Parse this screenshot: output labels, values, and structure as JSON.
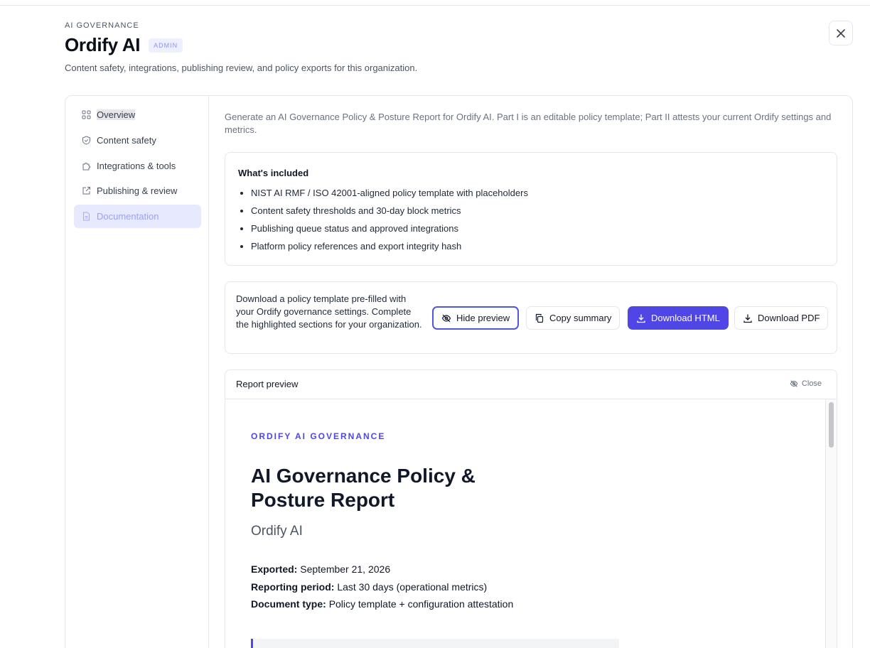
{
  "header": {
    "eyebrow": "AI GOVERNANCE",
    "title": "Ordify AI",
    "badge": "ADMIN",
    "subtitle": "Content safety, integrations, publishing review, and policy exports for this organization."
  },
  "sidebar": {
    "items": [
      {
        "label": "Overview",
        "icon": "grid-icon"
      },
      {
        "label": "Content safety",
        "icon": "shield-icon"
      },
      {
        "label": "Integrations & tools",
        "icon": "puzzle-icon"
      },
      {
        "label": "Publishing & review",
        "icon": "external-link-icon"
      },
      {
        "label": "Documentation",
        "icon": "document-icon",
        "active": true
      }
    ]
  },
  "main": {
    "intro": "Generate an AI Governance Policy & Posture Report for Ordify AI. Part I is an editable policy template; Part II attests your current Ordify settings and metrics.",
    "included": {
      "heading": "What's included",
      "items": [
        "NIST AI RMF / ISO 42001-aligned policy template with placeholders",
        "Content safety thresholds and 30-day block metrics",
        "Publishing queue status and approved integrations",
        "Platform policy references and export integrity hash"
      ]
    },
    "download": {
      "text": "Download a policy template pre-filled with your Ordify governance settings. Complete the highlighted sections for your organization.",
      "hide_preview": "Hide preview",
      "copy_summary": "Copy summary",
      "download_html": "Download HTML",
      "download_pdf": "Download PDF"
    },
    "preview": {
      "title": "Report preview",
      "close": "Close",
      "doc": {
        "eyebrow": "ORDIFY AI GOVERNANCE",
        "title": "AI Governance Policy & Posture Report",
        "org": "Ordify AI",
        "exported_label": "Exported:",
        "exported_value": "September 21, 2026",
        "period_label": "Reporting period:",
        "period_value": "Last 30 days (operational metrics)",
        "type_label": "Document type:",
        "type_value": "Policy template + configuration attestation"
      }
    }
  },
  "colors": {
    "accent": "#4f46e5",
    "active_nav_bg": "#e7e9ff",
    "badge_bg": "#eef0ff"
  }
}
